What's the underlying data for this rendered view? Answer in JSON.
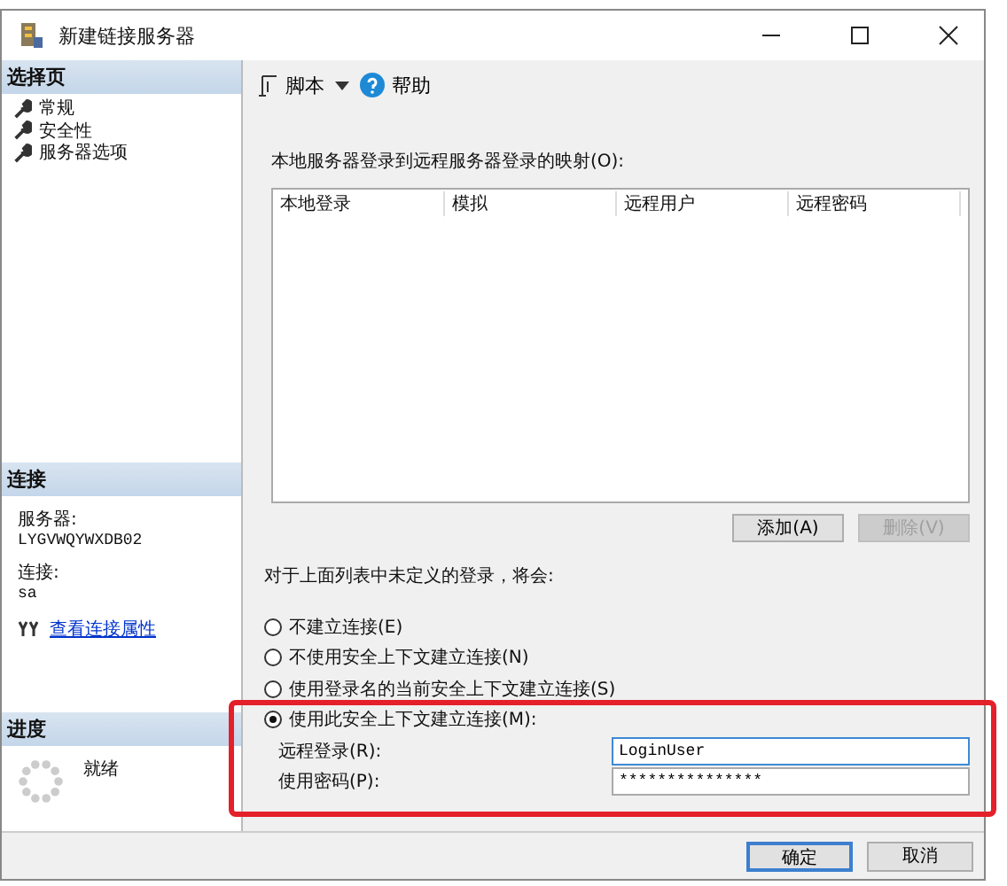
{
  "window": {
    "title": "新建链接服务器"
  },
  "sidebar": {
    "sections": [
      {
        "title": "选择页",
        "items": [
          {
            "label": "常规"
          },
          {
            "label": "安全性"
          },
          {
            "label": "服务器选项"
          }
        ]
      }
    ],
    "connection": {
      "title": "连接",
      "server_label": "服务器:",
      "server": "LYGVWQYWXDB02",
      "conn_label": "连接:",
      "conn": "sa",
      "link": "查看连接属性"
    },
    "progress": {
      "title": "进度",
      "status": "就绪"
    }
  },
  "toolbar": {
    "script": "脚本",
    "help": "帮助"
  },
  "mapping": {
    "label": "本地服务器登录到远程服务器登录的映射(O):",
    "columns": [
      "本地登录",
      "模拟",
      "远程用户",
      "远程密码"
    ],
    "buttons": [
      {
        "label": "添加(A)",
        "disabled": false
      },
      {
        "label": "删除(V)",
        "disabled": true
      }
    ]
  },
  "undefined_logins": {
    "label": "对于上面列表中未定义的登录，将会:",
    "options": [
      {
        "label": "不建立连接(E)",
        "selected": false
      },
      {
        "label": "不使用安全上下文建立连接(N)",
        "selected": false
      },
      {
        "label": "使用登录名的当前安全上下文建立连接(S)",
        "selected": false
      },
      {
        "label": "使用此安全上下文建立连接(M):",
        "selected": true
      }
    ]
  },
  "remote_login": {
    "label": "远程登录(R):",
    "value": "LoginUser"
  },
  "password": {
    "label": "使用密码(P):",
    "value": "***************"
  },
  "buttons": [
    {
      "label": "确定",
      "default": true
    },
    {
      "label": "取消",
      "default": false
    }
  ]
}
